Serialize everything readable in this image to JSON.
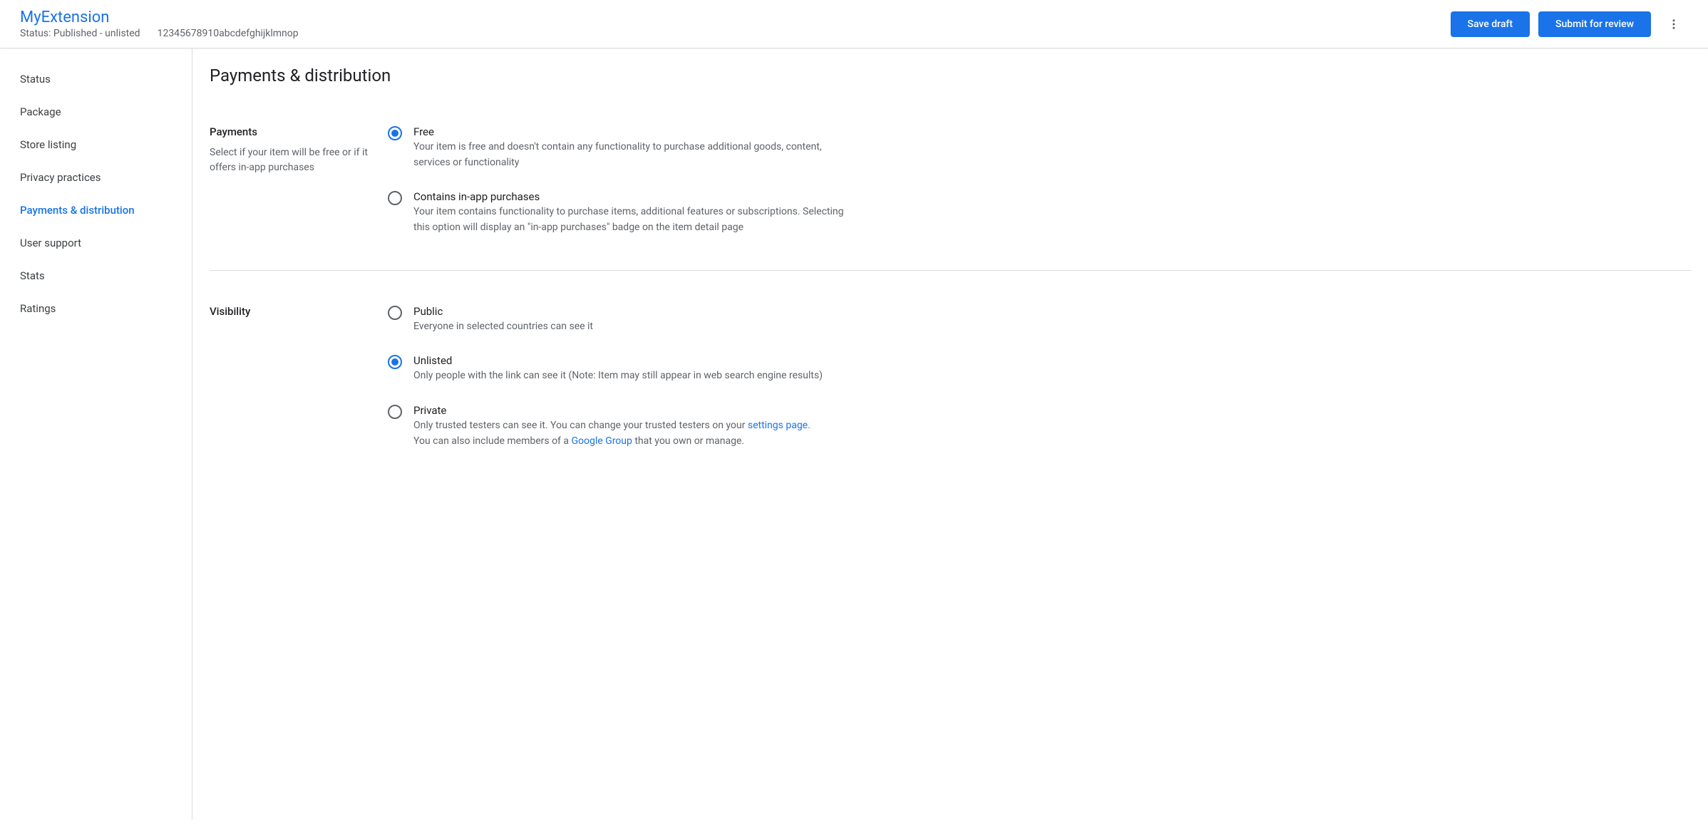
{
  "header": {
    "app_name": "MyExtension",
    "status_label": "Status: Published - unlisted",
    "item_id": "12345678910abcdefghijklmnop",
    "save_draft": "Save draft",
    "submit_for_review": "Submit for review"
  },
  "sidebar": {
    "items": [
      {
        "label": "Status",
        "active": false
      },
      {
        "label": "Package",
        "active": false
      },
      {
        "label": "Store listing",
        "active": false
      },
      {
        "label": "Privacy practices",
        "active": false
      },
      {
        "label": "Payments & distribution",
        "active": true
      },
      {
        "label": "User support",
        "active": false
      },
      {
        "label": "Stats",
        "active": false
      },
      {
        "label": "Ratings",
        "active": false
      }
    ]
  },
  "main": {
    "title": "Payments & distribution",
    "payments": {
      "title": "Payments",
      "help": "Select if your item will be free or if it offers in-app purchases",
      "options": [
        {
          "label": "Free",
          "desc": "Your item is free and doesn't contain any functionality to purchase additional goods, content, services or functionality",
          "selected": true
        },
        {
          "label": "Contains in-app purchases",
          "desc": "Your item contains functionality to purchase items, additional features or subscriptions. Selecting this option will display an \"in-app purchases\" badge on the item detail page",
          "selected": false
        }
      ]
    },
    "visibility": {
      "title": "Visibility",
      "options": [
        {
          "label": "Public",
          "desc": "Everyone in selected countries can see it",
          "selected": false
        },
        {
          "label": "Unlisted",
          "desc": "Only people with the link can see it (Note: Item may still appear in web search engine results)",
          "selected": true
        },
        {
          "label": "Private",
          "desc_part1": "Only trusted testers can see it. You can change your trusted testers on your ",
          "link1": "settings page",
          "desc_part2": ".",
          "desc_part3": "You can also include members of a ",
          "link2": "Google Group",
          "desc_part4": " that you own or manage.",
          "selected": false
        }
      ]
    }
  }
}
